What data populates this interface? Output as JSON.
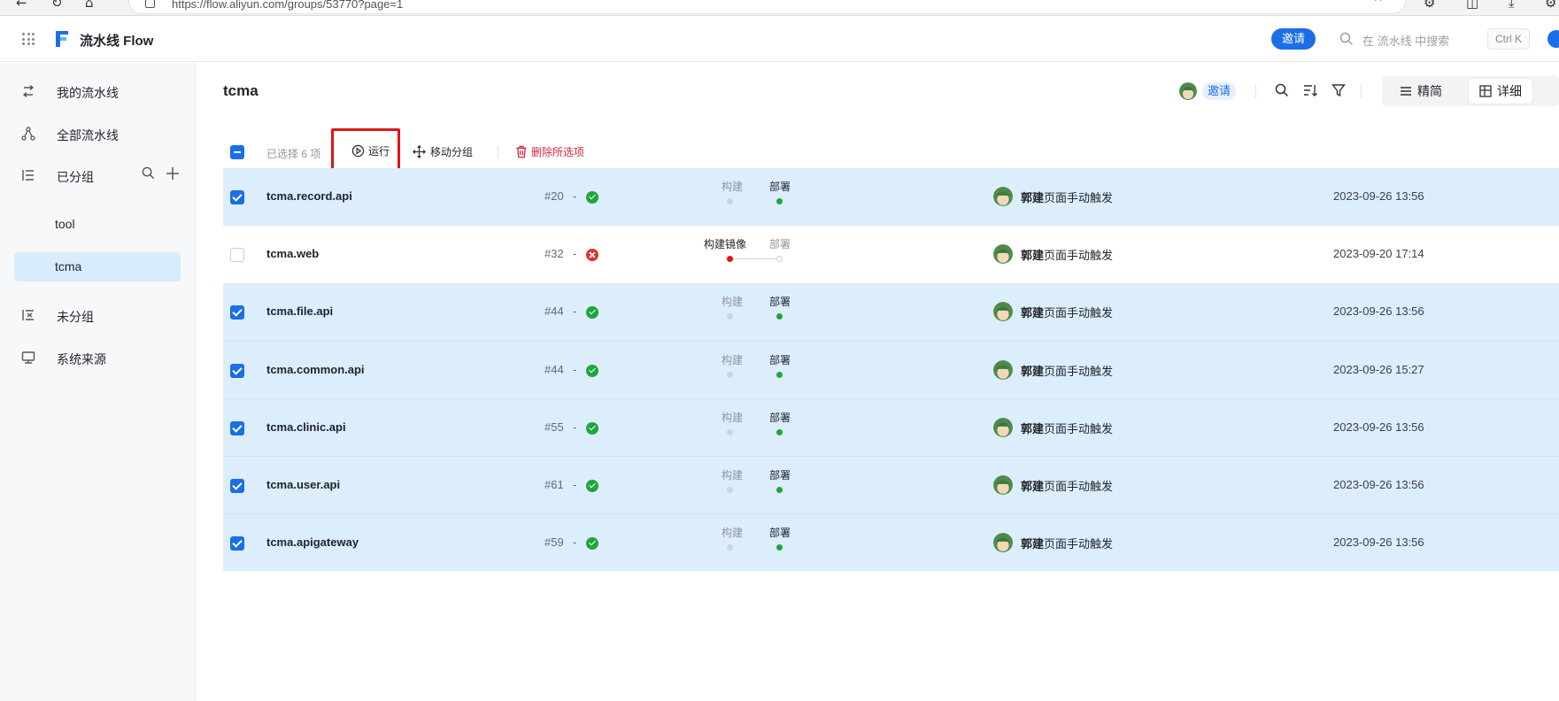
{
  "browser": {
    "url": "https://flow.aliyun.com/groups/53770?page=1"
  },
  "header": {
    "app_title": "流水线 Flow",
    "invite_label": "邀请",
    "search_placeholder": "在 流水线 中搜索",
    "shortcut": "Ctrl K"
  },
  "sidebar": {
    "items": [
      {
        "label": "我的流水线",
        "icon": "switch-icon"
      },
      {
        "label": "全部流水线",
        "icon": "network-icon"
      },
      {
        "label": "已分组",
        "icon": "list-tree-icon"
      },
      {
        "label": "未分组",
        "icon": "ungrouped-icon"
      },
      {
        "label": "系统来源",
        "icon": "monitor-icon"
      }
    ],
    "groups": [
      {
        "label": "tool",
        "active": false
      },
      {
        "label": "tcma",
        "active": true
      }
    ]
  },
  "main": {
    "title": "tcma",
    "invite_label": "邀请",
    "view_simple": "精简",
    "view_detail": "详细",
    "selected_text": "已选择 6 项",
    "run_label": "运行",
    "move_label": "移动分组",
    "delete_label": "删除所选项"
  },
  "colors": {
    "accent": "#1b6ee6",
    "selected_row": "#dcedfb",
    "success": "#20a53a",
    "danger": "#e11414"
  },
  "rows": [
    {
      "name": "tcma.record.api",
      "build": "#20",
      "dash": "-",
      "status": "success",
      "stage1": "构建",
      "stage2": "部署",
      "user": "郭建",
      "trigger": "页面手动触发",
      "time": "2023-09-26 13:56",
      "checked": true
    },
    {
      "name": "tcma.web",
      "build": "#32",
      "dash": "-",
      "status": "failed",
      "stage1": "构建镜像",
      "stage2": "部署",
      "user": "郭建",
      "trigger": "页面手动触发",
      "time": "2023-09-20 17:14",
      "checked": false
    },
    {
      "name": "tcma.file.api",
      "build": "#44",
      "dash": "-",
      "status": "success",
      "stage1": "构建",
      "stage2": "部署",
      "user": "郭建",
      "trigger": "页面手动触发",
      "time": "2023-09-26 13:56",
      "checked": true
    },
    {
      "name": "tcma.common.api",
      "build": "#44",
      "dash": "-",
      "status": "success",
      "stage1": "构建",
      "stage2": "部署",
      "user": "郭建",
      "trigger": "页面手动触发",
      "time": "2023-09-26 15:27",
      "checked": true
    },
    {
      "name": "tcma.clinic.api",
      "build": "#55",
      "dash": "-",
      "status": "success",
      "stage1": "构建",
      "stage2": "部署",
      "user": "郭建",
      "trigger": "页面手动触发",
      "time": "2023-09-26 13:56",
      "checked": true
    },
    {
      "name": "tcma.user.api",
      "build": "#61",
      "dash": "-",
      "status": "success",
      "stage1": "构建",
      "stage2": "部署",
      "user": "郭建",
      "trigger": "页面手动触发",
      "time": "2023-09-26 13:56",
      "checked": true
    },
    {
      "name": "tcma.apigateway",
      "build": "#59",
      "dash": "-",
      "status": "success",
      "stage1": "构建",
      "stage2": "部署",
      "user": "郭建",
      "trigger": "页面手动触发",
      "time": "2023-09-26 13:56",
      "checked": true
    }
  ]
}
